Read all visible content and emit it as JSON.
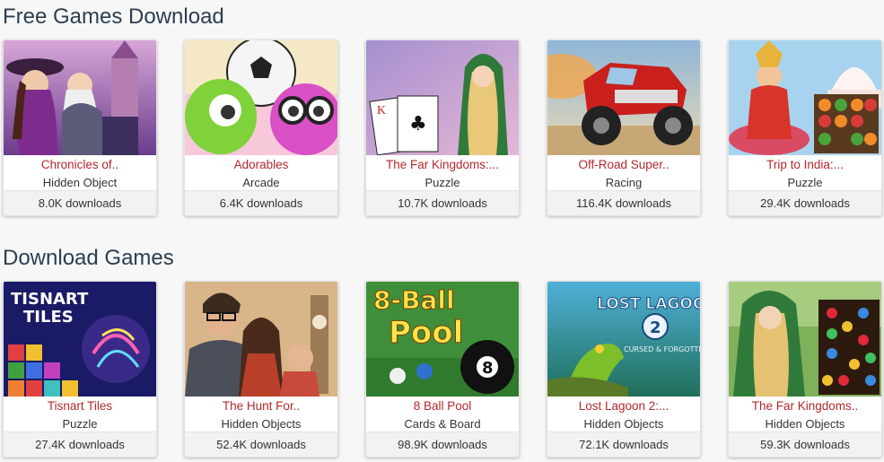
{
  "sections": [
    {
      "title": "Free Games Download",
      "games": [
        {
          "name": "Chronicles of..",
          "genre": "Hidden Object",
          "downloads": "8.0K downloads"
        },
        {
          "name": "Adorables",
          "genre": "Arcade",
          "downloads": "6.4K downloads"
        },
        {
          "name": "The Far Kingdoms:...",
          "genre": "Puzzle",
          "downloads": "10.7K downloads"
        },
        {
          "name": "Off-Road Super..",
          "genre": "Racing",
          "downloads": "116.4K downloads"
        },
        {
          "name": "Trip to India:...",
          "genre": "Puzzle",
          "downloads": "29.4K downloads"
        }
      ]
    },
    {
      "title": "Download Games",
      "games": [
        {
          "name": "Tisnart Tiles",
          "genre": "Puzzle",
          "downloads": "27.4K downloads",
          "art_text": [
            "TISNART",
            "TILES"
          ]
        },
        {
          "name": "The Hunt For..",
          "genre": "Hidden Objects",
          "downloads": "52.4K downloads"
        },
        {
          "name": "8 Ball Pool",
          "genre": "Cards & Board",
          "downloads": "98.9K downloads",
          "art_text": [
            "8-Ball",
            "Pool"
          ]
        },
        {
          "name": "Lost Lagoon 2:...",
          "genre": "Hidden Objects",
          "downloads": "72.1K downloads",
          "art_text": [
            "LOST LAGOON",
            "CURSED & FORGOTTEN"
          ]
        },
        {
          "name": "The Far Kingdoms..",
          "genre": "Hidden Objects",
          "downloads": "59.3K downloads"
        }
      ]
    }
  ],
  "colors": {
    "title": "#2c3e50",
    "game_name": "#b3282d",
    "footer_bg": "#f2f2f2"
  }
}
